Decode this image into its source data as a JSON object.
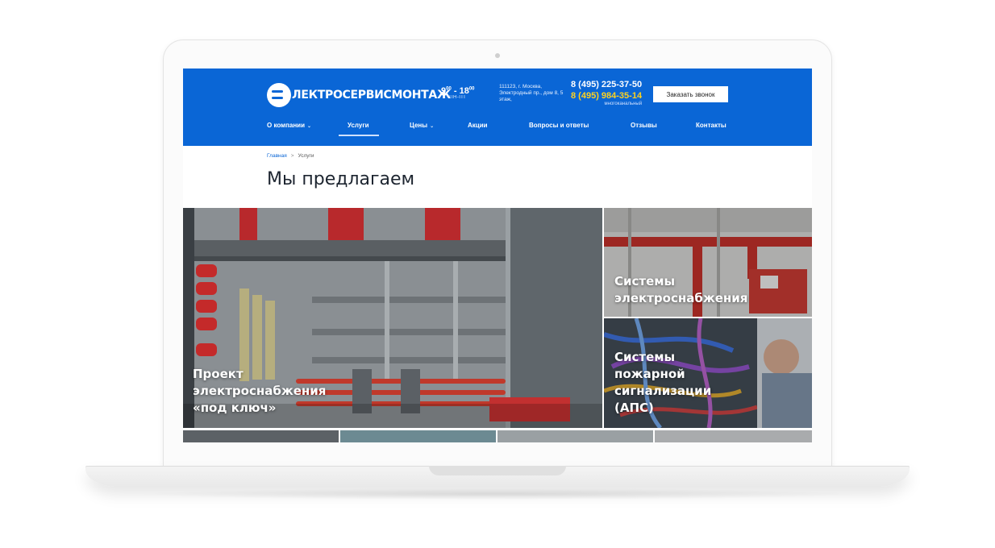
{
  "header": {
    "logo_text": "ЛЕКТРОСЕРВИСМОНТАЖ",
    "hours": {
      "from": "9",
      "from_sup": "00",
      "sep": " - ",
      "to": "18",
      "to_sup": "00",
      "days": "ПН-ПТ"
    },
    "address": "111123, г. Москва, Электродный пр., дом 8, 5 этаж,",
    "phone_primary": "8 (495) 225-37-50",
    "phone_secondary": "8 (495) 984-35-14",
    "phone_note": "многоканальный",
    "callback_label": "Заказать звонок"
  },
  "nav": {
    "items": [
      {
        "label": "О компании",
        "has_dropdown": true
      },
      {
        "label": "Услуги",
        "has_dropdown": false,
        "active": true
      },
      {
        "label": "Цены",
        "has_dropdown": true
      },
      {
        "label": "Акции",
        "has_dropdown": false
      },
      {
        "label": "Вопросы и ответы",
        "has_dropdown": false
      },
      {
        "label": "Отзывы",
        "has_dropdown": false
      },
      {
        "label": "Контакты",
        "has_dropdown": false
      }
    ],
    "caret": "⌄"
  },
  "breadcrumb": {
    "home": "Главная",
    "separator": ">",
    "current": "Услуги"
  },
  "page_title": "Мы предлагаем",
  "services": {
    "big_title": [
      "Проект",
      "электроснабжения",
      "«под ключ»"
    ],
    "right_top_title": [
      "Системы",
      "электроснабжения"
    ],
    "right_bottom_title": [
      "Системы",
      "пожарной",
      "сигнализации",
      "(АПС)"
    ]
  },
  "colors": {
    "header_blue": "#0a66d6",
    "phone_accent": "#ffd21f"
  }
}
